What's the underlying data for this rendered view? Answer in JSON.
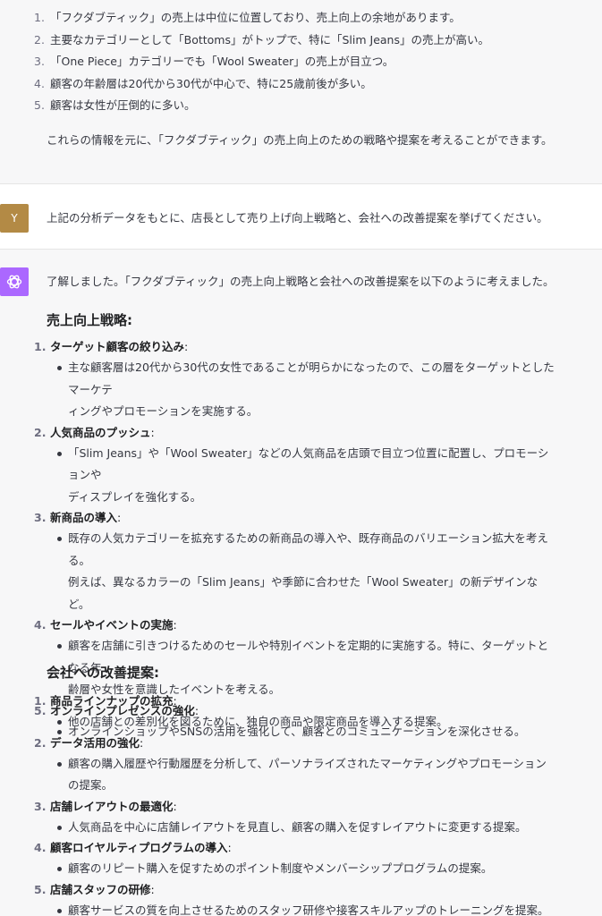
{
  "previous_answer": {
    "items": [
      {
        "n": "1.",
        "text": "「フクダブティック」の売上は中位に位置しており、売上向上の余地があります。"
      },
      {
        "n": "2.",
        "text": "主要なカテゴリーとして「Bottoms」がトップで、特に「Slim Jeans」の売上が高い。"
      },
      {
        "n": "3.",
        "text": "「One Piece」カテゴリーでも「Wool Sweater」の売上が目立つ。"
      },
      {
        "n": "4.",
        "text": "顧客の年齢層は20代から30代が中心で、特に25歳前後が多い。"
      },
      {
        "n": "5.",
        "text": "顧客は女性が圧倒的に多い。"
      }
    ],
    "summary": "これらの情報を元に、「フクダブティック」の売上向上のための戦略や提案を考えることができます。"
  },
  "user_message": {
    "avatar_letter": "Y",
    "text": "上記の分析データをもとに、店長として売り上げ向上戦略と、会社への改善提案を挙げてください。"
  },
  "reply": {
    "intro": "了解しました。「フクダブティック」の売上向上戦略と会社への改善提案を以下のように考えました。",
    "sales_heading": "売上向上戦略:",
    "sales_items": [
      {
        "n": "1.",
        "title": "ターゲット顧客の絞り込み",
        "bullet_lines": [
          "主な顧客層は20代から30代の女性であることが明らかになったので、この層をターゲットとしたマーケテ",
          "ィングやプロモーションを実施する。"
        ]
      },
      {
        "n": "2.",
        "title": "人気商品のプッシュ",
        "bullet_lines": [
          "「Slim Jeans」や「Wool Sweater」などの人気商品を店頭で目立つ位置に配置し、プロモーションや",
          "ディスプレイを強化する。"
        ]
      },
      {
        "n": "3.",
        "title": "新商品の導入",
        "bullet_lines": [
          "既存の人気カテゴリーを拡充するための新商品の導入や、既存商品のバリエーション拡大を考える。",
          "例えば、異なるカラーの「Slim Jeans」や季節に合わせた「Wool Sweater」の新デザインなど。"
        ]
      },
      {
        "n": "4.",
        "title": "セールやイベントの実施",
        "bullet_lines": [
          "顧客を店舗に引きつけるためのセールや特別イベントを定期的に実施する。特に、ターゲットとなる年",
          "齢層や女性を意識したイベントを考える。"
        ]
      },
      {
        "n": "5.",
        "title": "オンラインプレゼンスの強化",
        "bullet_lines": [
          "オンラインショップやSNSの活用を強化して、顧客とのコミュニケーションを深化させる。"
        ]
      }
    ],
    "company_heading": "会社への改善提案:",
    "company_items": [
      {
        "n": "1.",
        "title": "商品ラインナップの拡充",
        "bullet_lines": [
          "他の店舗との差別化を図るために、独自の商品や限定商品を導入する提案。"
        ]
      },
      {
        "n": "2.",
        "title": "データ活用の強化",
        "bullet_lines": [
          "顧客の購入履歴や行動履歴を分析して、パーソナライズされたマーケティングやプロモーションの提案。"
        ]
      },
      {
        "n": "3.",
        "title": "店舗レイアウトの最適化",
        "bullet_lines": [
          "人気商品を中心に店舗レイアウトを見直し、顧客の購入を促すレイアウトに変更する提案。"
        ]
      },
      {
        "n": "4.",
        "title": "顧客ロイヤルティプログラムの導入",
        "bullet_lines": [
          "顧客のリピート購入を促すためのポイント制度やメンバーシッププログラムの提案。"
        ]
      },
      {
        "n": "5.",
        "title": "店舗スタッフの研修",
        "bullet_lines": [
          "顧客サービスの質を向上させるためのスタッフ研修や接客スキルアップのトレーニングを提案。"
        ]
      }
    ]
  },
  "colors": {
    "assistant_bg": "#f7f7f8",
    "user_bg": "#ffffff",
    "user_avatar": "#b38a45",
    "assistant_avatar": "#ab68ff",
    "text": "#353740"
  },
  "icons": {
    "assistant_avatar": "openai-logo-icon"
  }
}
